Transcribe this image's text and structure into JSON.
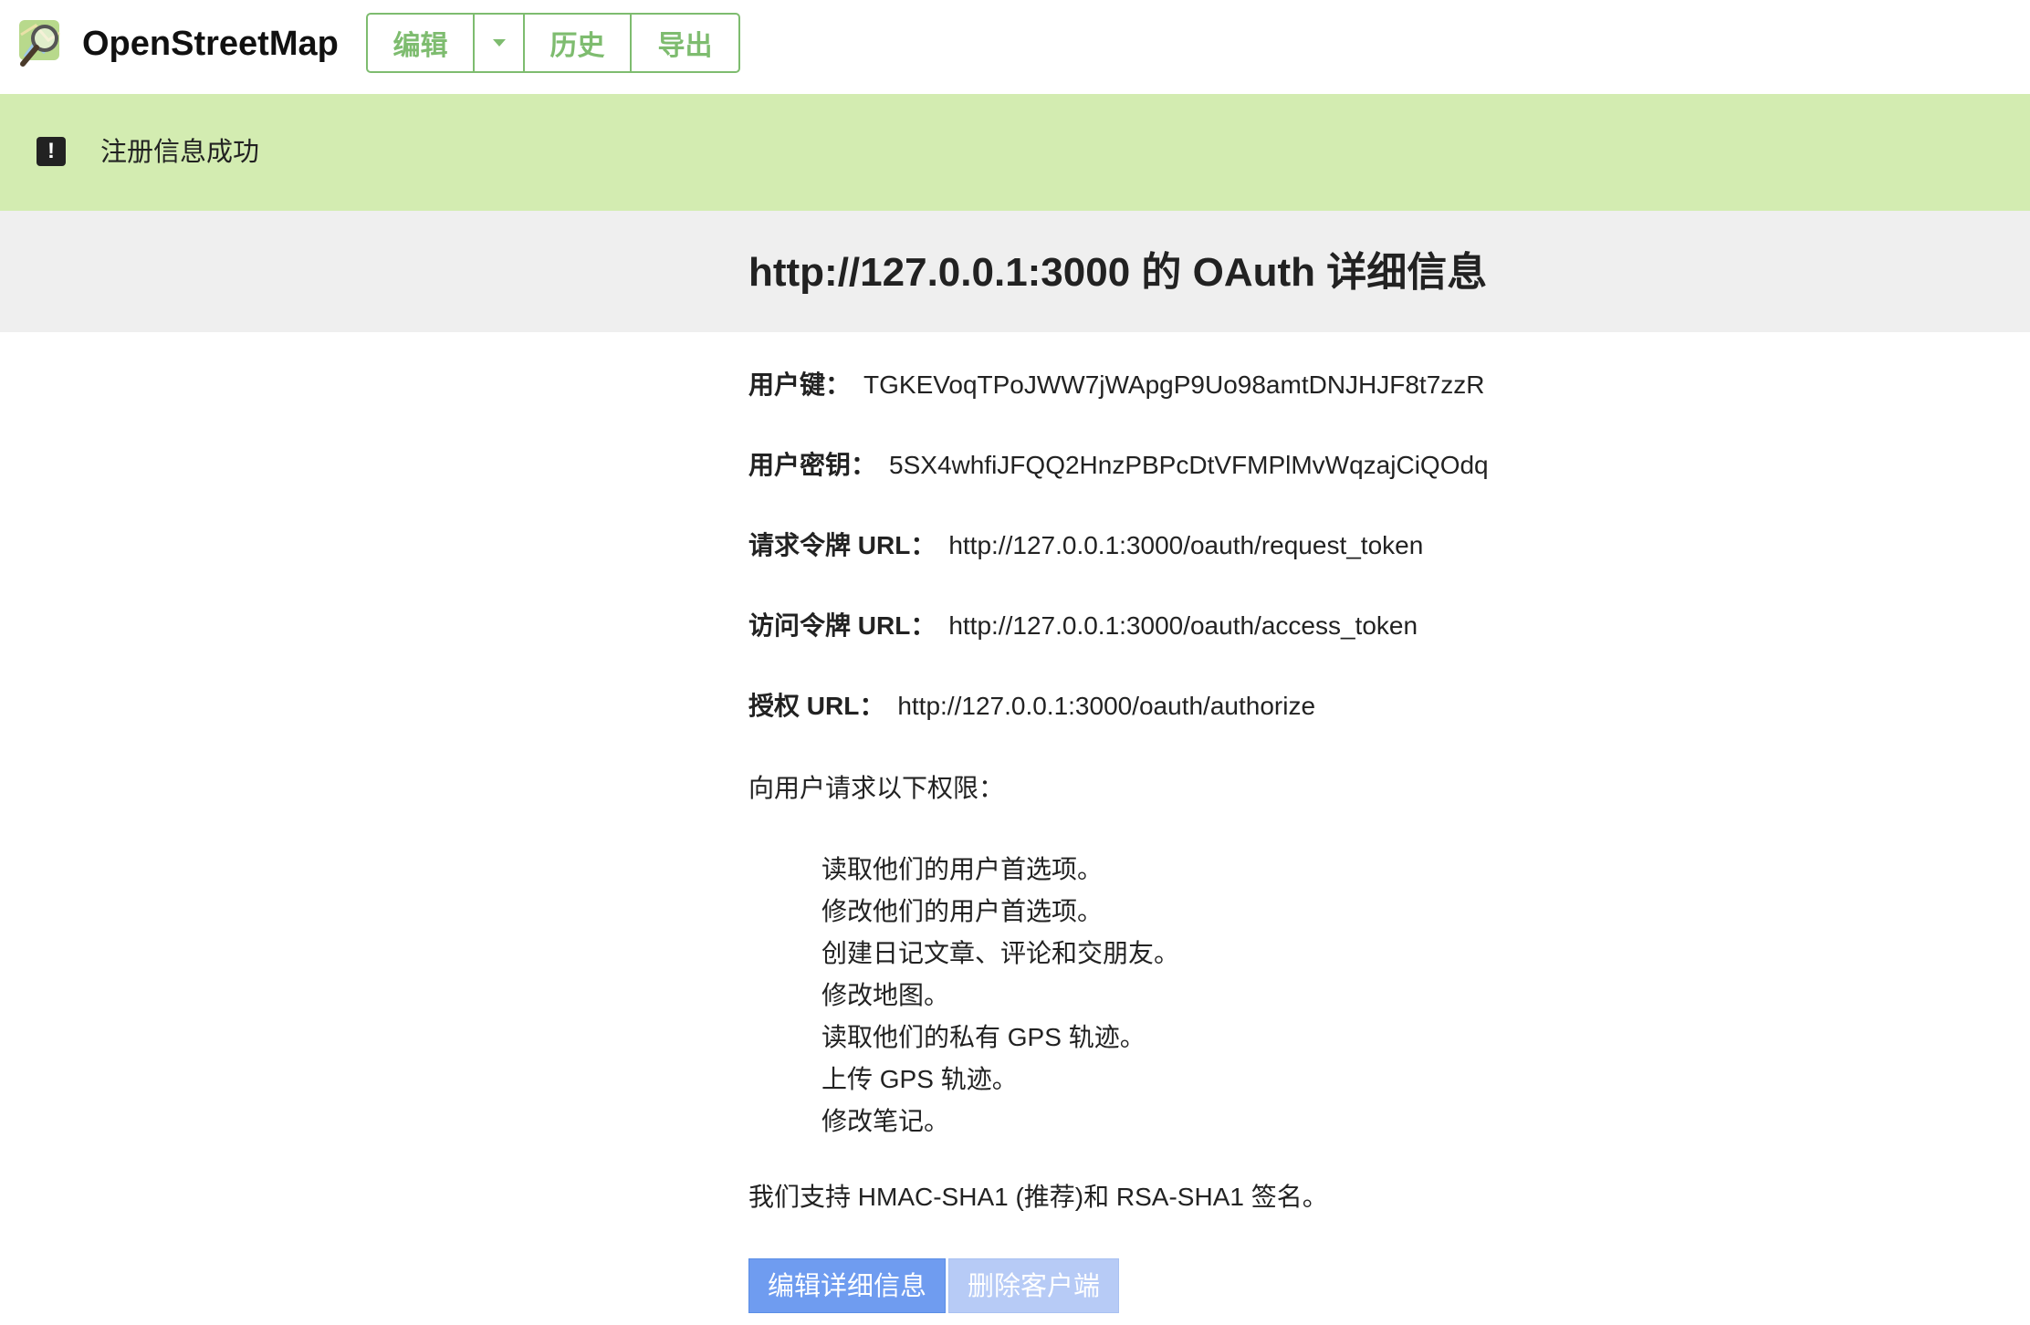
{
  "header": {
    "brand": "OpenStreetMap",
    "tabs": {
      "edit": "编辑",
      "history": "历史",
      "export": "导出"
    }
  },
  "flash": {
    "message": "注册信息成功"
  },
  "page": {
    "title": "http://127.0.0.1:3000 的 OAuth 详细信息"
  },
  "details": [
    {
      "label": "用户键：",
      "value": "TGKEVoqTPoJWW7jWApgP9Uo98amtDNJHJF8t7zzR"
    },
    {
      "label": "用户密钥：",
      "value": "5SX4whfiJFQQ2HnzPBPcDtVFMPlMvWqzajCiQOdq"
    },
    {
      "label": "请求令牌 URL：",
      "value": "http://127.0.0.1:3000/oauth/request_token"
    },
    {
      "label": "访问令牌 URL：",
      "value": "http://127.0.0.1:3000/oauth/access_token"
    },
    {
      "label": "授权 URL：",
      "value": "http://127.0.0.1:3000/oauth/authorize"
    }
  ],
  "permissions": {
    "intro": "向用户请求以下权限：",
    "items": [
      "读取他们的用户首选项。",
      "修改他们的用户首选项。",
      "创建日记文章、评论和交朋友。",
      "修改地图。",
      "读取他们的私有 GPS 轨迹。",
      "上传 GPS 轨迹。",
      "修改笔记。"
    ]
  },
  "signature_text": "我们支持 HMAC-SHA1 (推荐)和 RSA-SHA1 签名。",
  "actions": {
    "edit": "编辑详细信息",
    "delete": "删除客户端"
  },
  "colors": {
    "accent_green": "#7ebc6f",
    "flash_bg": "#d3ecb1",
    "primary_blue": "#6f9cf0"
  }
}
